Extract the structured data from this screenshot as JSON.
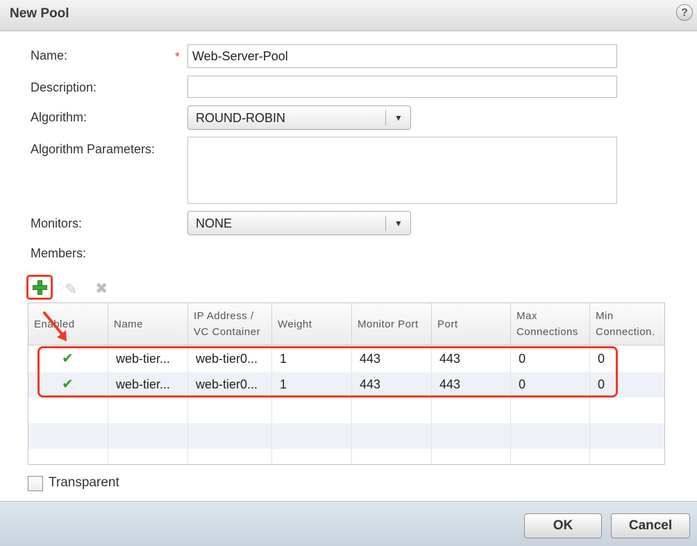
{
  "dialog": {
    "title": "New Pool",
    "help_glyph": "?"
  },
  "form": {
    "name_label": "Name:",
    "name_required_mark": "*",
    "name_value": "Web-Server-Pool",
    "description_label": "Description:",
    "description_value": "",
    "algorithm_label": "Algorithm:",
    "algorithm_value": "ROUND-ROBIN",
    "algorithm_params_label": "Algorithm Parameters:",
    "algorithm_params_value": "",
    "monitors_label": "Monitors:",
    "monitors_value": "NONE",
    "members_label": "Members:"
  },
  "toolbar": {
    "add_icon": "plus-icon",
    "edit_icon": "pencil-icon",
    "delete_icon": "x-icon"
  },
  "members_table": {
    "headers": [
      "Enabled",
      "Name",
      "IP Address / VC Container",
      "Weight",
      "Monitor Port",
      "Port",
      "Max Connections",
      "Min Connection."
    ],
    "rows": [
      {
        "enabled": true,
        "name": "web-tier...",
        "ip": "web-tier0...",
        "weight": "1",
        "monitor_port": "443",
        "port": "443",
        "max_conn": "0",
        "min_conn": "0"
      },
      {
        "enabled": true,
        "name": "web-tier...",
        "ip": "web-tier0...",
        "weight": "1",
        "monitor_port": "443",
        "port": "443",
        "max_conn": "0",
        "min_conn": "0"
      }
    ],
    "check_glyph": "✔"
  },
  "transparent": {
    "label": "Transparent",
    "checked": false
  },
  "buttons": {
    "ok": "OK",
    "cancel": "Cancel"
  },
  "colors": {
    "accent_red": "#ee3a24",
    "check_green": "#2a9d2a",
    "plus_green": "#3aa83a"
  }
}
